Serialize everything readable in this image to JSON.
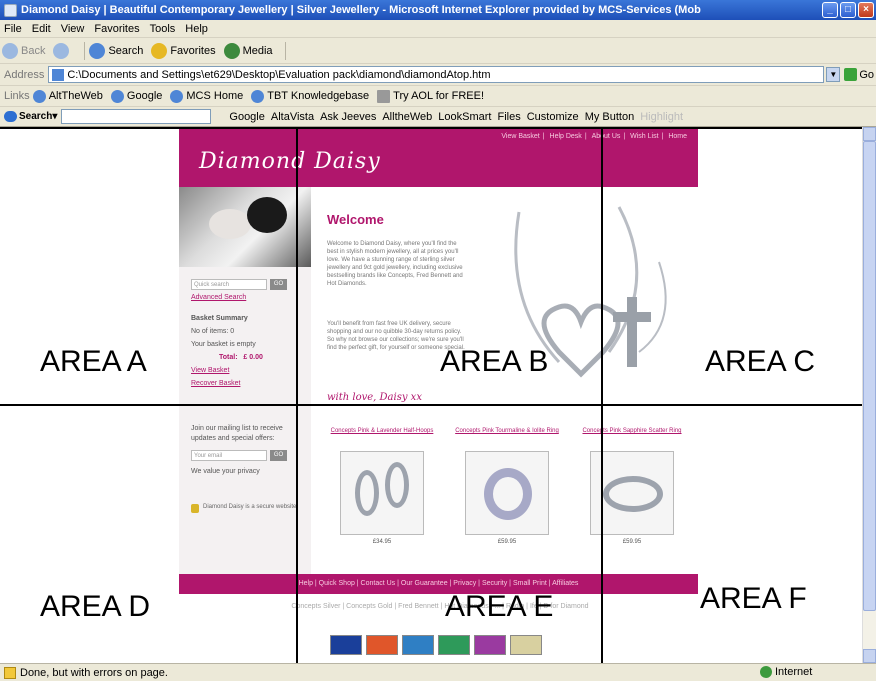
{
  "window": {
    "title": "Diamond Daisy | Beautiful Contemporary Jewellery | Silver Jewellery - Microsoft Internet Explorer provided by MCS-Services (Mob"
  },
  "menu": [
    "File",
    "Edit",
    "View",
    "Favorites",
    "Tools",
    "Help"
  ],
  "toolbar": {
    "back": "Back",
    "search": "Search",
    "favorites": "Favorites",
    "media": "Media"
  },
  "address": {
    "label": "Address",
    "value": "C:\\Documents and Settings\\et629\\Desktop\\Evaluation pack\\diamond\\diamondAtop.htm",
    "go": "Go"
  },
  "links": {
    "label": "Links",
    "items": [
      "AltTheWeb",
      "Google",
      "MCS Home",
      "TBT Knowledgebase",
      "Try AOL for FREE!"
    ]
  },
  "searchbar": {
    "label": "Search",
    "items": [
      "Google",
      "AltaVista",
      "Ask Jeeves",
      "AlltheWeb",
      "LookSmart",
      "Files",
      "Customize",
      "My Button",
      "Highlight"
    ]
  },
  "site": {
    "logo": "Diamond Daisy",
    "top_nav": [
      "View Basket",
      "Help Desk",
      "About Us",
      "Wish List",
      "Home"
    ],
    "quick_search_placeholder": "Quick search",
    "go_label": "GO",
    "advanced_search": "Advanced Search",
    "basket": {
      "title": "Basket Summary",
      "items": "No of items: 0",
      "empty": "Your basket is empty",
      "total_label": "Total:",
      "total_value": "£ 0.00",
      "view": "View Basket",
      "recover": "Recover Basket"
    },
    "mailing": {
      "text": "Join our mailing list to receive updates and special offers:",
      "placeholder": "Your email",
      "privacy": "We value your privacy"
    },
    "secure": "Diamond Daisy is a secure website",
    "welcome": "Welcome",
    "intro": "Welcome to Diamond Daisy, where you'll find the best in stylish modern jewellery, all at prices you'll love. We have a stunning range of sterling silver jewellery and 9ct gold jewellery, including exclusive bestselling brands like Concepts, Fred Bennett and Hot Diamonds.",
    "intro2": "You'll benefit from fast free UK delivery, secure shopping and our no quibble 30-day returns policy. So why not browse our collections; we're sure you'll find the perfect gift, for yourself or someone special.",
    "signoff": "with love, Daisy xx",
    "products": [
      {
        "name": "Concepts Pink & Lavender Half-Hoops",
        "price": "£34.95"
      },
      {
        "name": "Concepts Pink Tourmaline & Iolite Ring",
        "price": "£59.95"
      },
      {
        "name": "Concepts Pink Sapphire Scatter Ring",
        "price": "£59.95"
      }
    ],
    "footer": "Help | Quick Shop | Contact Us | Our Guarantee | Privacy | Security | Small Print | Affiliates",
    "seo_links": "Concepts Silver | Concepts Gold | Fred Bennett | Hot Diamonds | ... | Radio | Ife | D for Diamond"
  },
  "areas": [
    "AREA A",
    "AREA B",
    "AREA C",
    "AREA D",
    "AREA E",
    "AREA F"
  ],
  "status": {
    "text": "Done, but with errors on page.",
    "zone": "Internet"
  },
  "colors": {
    "brand": "#b0166c",
    "chrome": "#ece9d8",
    "titlebar": "#1e4fb8"
  }
}
